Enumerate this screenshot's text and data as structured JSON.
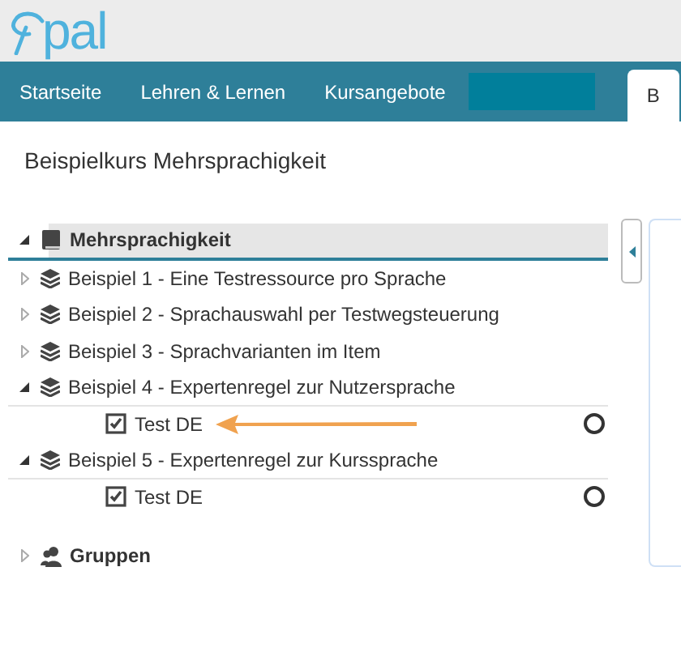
{
  "logo": {
    "text": "pal"
  },
  "nav": [
    {
      "label": "Startseite",
      "selected": false
    },
    {
      "label": "Lehren & Lernen",
      "selected": false
    },
    {
      "label": "Kursangebote",
      "selected": false
    },
    {
      "label": "B",
      "selected": true
    }
  ],
  "course_title": "Beispielkurs Mehrsprachigkeit",
  "tree": [
    {
      "label": "Mehrsprachigkeit",
      "kind": "course",
      "expanded": true,
      "selected": true,
      "children": [
        {
          "label": "Beispiel 1 - Eine Testressource pro Sprache",
          "kind": "folder",
          "expanded": false
        },
        {
          "label": "Beispiel 2 - Sprachauswahl per Testwegsteuerung",
          "kind": "folder",
          "expanded": false
        },
        {
          "label": "Beispiel 3 - Sprachvarianten im Item",
          "kind": "folder",
          "expanded": false
        },
        {
          "label": "Beispiel 4 - Expertenregel zur Nutzersprache",
          "kind": "folder",
          "expanded": true,
          "children": [
            {
              "label": "Test DE",
              "kind": "test",
              "annotated": true
            }
          ]
        },
        {
          "label": "Beispiel 5 - Expertenregel zur Kurssprache",
          "kind": "folder",
          "expanded": true,
          "children": [
            {
              "label": "Test DE",
              "kind": "test",
              "annotated": false
            }
          ]
        }
      ]
    },
    {
      "label": "Gruppen",
      "kind": "groups",
      "expanded": false,
      "selected": false
    }
  ]
}
